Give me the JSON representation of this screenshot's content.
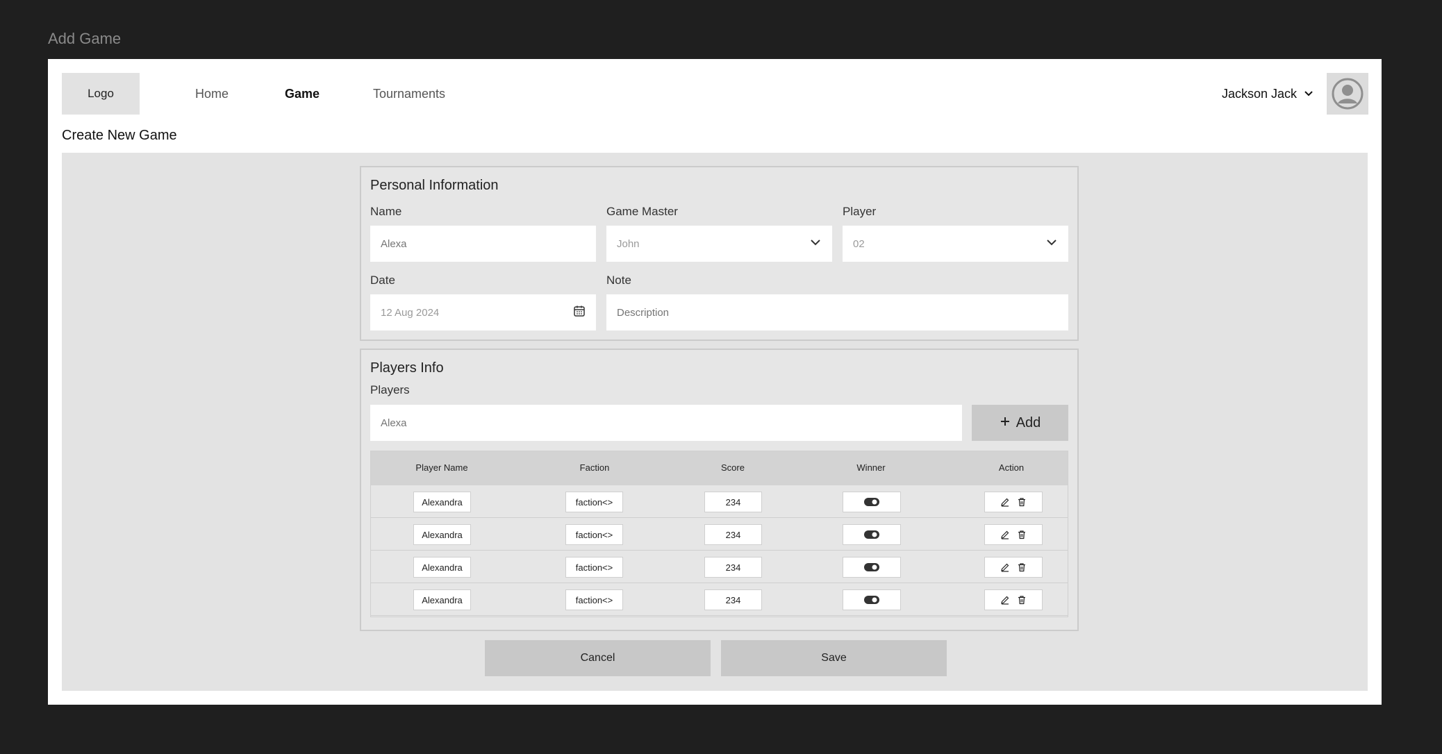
{
  "frame": {
    "title": "Add Game"
  },
  "nav": {
    "logo": "Logo",
    "items": [
      {
        "label": "Home",
        "active": false
      },
      {
        "label": "Game",
        "active": true
      },
      {
        "label": "Tournaments",
        "active": false
      }
    ],
    "user": {
      "name": "Jackson Jack"
    }
  },
  "page": {
    "title": "Create New Game"
  },
  "personal": {
    "title": "Personal Information",
    "name": {
      "label": "Name",
      "placeholder": "Alexa"
    },
    "game_master": {
      "label": "Game Master",
      "value": "John"
    },
    "player": {
      "label": "Player",
      "value": "02"
    },
    "date": {
      "label": "Date",
      "value": "12 Aug 2024"
    },
    "note": {
      "label": "Note",
      "placeholder": "Description"
    }
  },
  "players_info": {
    "title": "Players Info",
    "players_label": "Players",
    "players_placeholder": "Alexa",
    "add_label": "Add",
    "columns": [
      "Player Name",
      "Faction",
      "Score",
      "Winner",
      "Action"
    ],
    "rows": [
      {
        "name": "Alexandra",
        "faction": "faction<>",
        "score": "234",
        "winner": true
      },
      {
        "name": "Alexandra",
        "faction": "faction<>",
        "score": "234",
        "winner": true
      },
      {
        "name": "Alexandra",
        "faction": "faction<>",
        "score": "234",
        "winner": true
      },
      {
        "name": "Alexandra",
        "faction": "faction<>",
        "score": "234",
        "winner": true
      }
    ]
  },
  "actions": {
    "cancel": "Cancel",
    "save": "Save"
  },
  "colors": {
    "background": "#1f1f1f",
    "canvas": "#ffffff",
    "content": "#e3e3e3",
    "button": "#c8c8c8"
  }
}
